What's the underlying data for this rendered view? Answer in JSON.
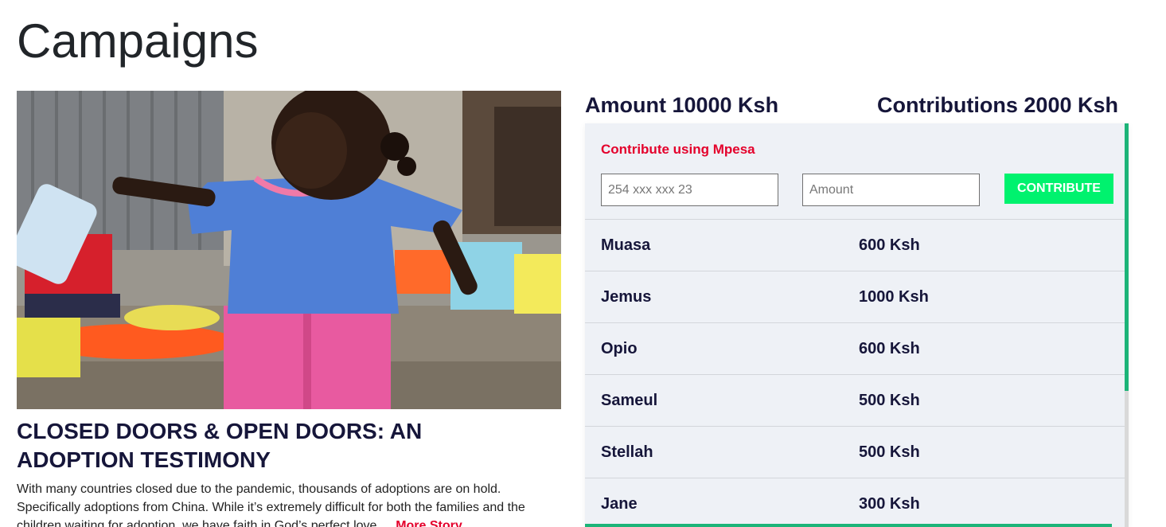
{
  "page": {
    "title": "Campaigns"
  },
  "story": {
    "title": "CLOSED DOORS & OPEN DOORS: AN ADOPTION TESTIMONY",
    "excerpt": "With many countries closed due to the pandemic, thousands of adoptions are on hold. Specifically adoptions from China. While it’s extremely difficult for both the families and the children waiting for adoption, we have faith in God’s perfect love...",
    "more_label": "More Story"
  },
  "totals": {
    "amount": "Amount 10000 Ksh",
    "contributions": "Contributions 2000 Ksh"
  },
  "contribute_form": {
    "title": "Contribute using Mpesa",
    "phone_placeholder": "254 xxx xxx 23",
    "amount_placeholder": "Amount",
    "button_label": "CONTRIBUTE"
  },
  "contributions": [
    {
      "name": "Muasa",
      "amount": "600 Ksh"
    },
    {
      "name": "Jemus",
      "amount": "1000 Ksh"
    },
    {
      "name": "Opio",
      "amount": "600 Ksh"
    },
    {
      "name": "Sameul",
      "amount": "500 Ksh"
    },
    {
      "name": "Stellah",
      "amount": "500 Ksh"
    },
    {
      "name": "Jane",
      "amount": "300 Ksh"
    }
  ],
  "colors": {
    "accent_red": "#e4002b",
    "button_green": "#00f26e",
    "scroll_green": "#1cb478",
    "panel_bg": "#eef1f6",
    "heading_navy": "#16163a"
  }
}
